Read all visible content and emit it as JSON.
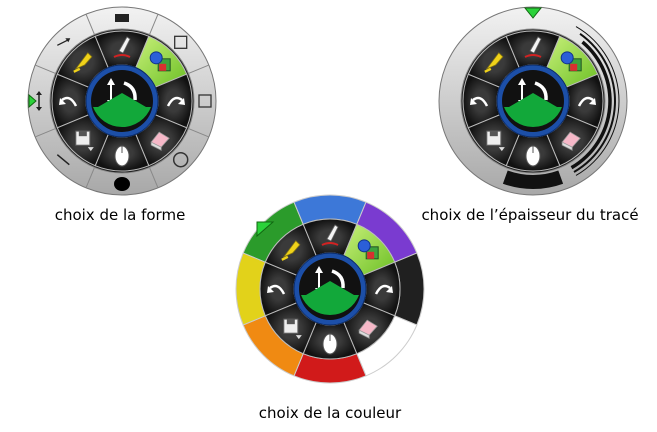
{
  "panels": [
    {
      "caption": "choix de la forme",
      "mode": "shape"
    },
    {
      "caption": "choix de l’épaisseur du tracé",
      "mode": "thickness"
    },
    {
      "caption": "choix de la couleur",
      "mode": "color"
    }
  ],
  "wheel": {
    "sectors": [
      {
        "name": "undo-icon",
        "interactable": true
      },
      {
        "name": "highlighter-icon",
        "interactable": true
      },
      {
        "name": "pen-icon",
        "interactable": true
      },
      {
        "name": "shapes-icon",
        "interactable": true,
        "selected": true
      },
      {
        "name": "redo-icon",
        "interactable": true
      },
      {
        "name": "eraser-icon",
        "interactable": true
      },
      {
        "name": "mouse-pointer-icon",
        "interactable": true
      },
      {
        "name": "save-icon",
        "interactable": true
      }
    ],
    "center": {
      "top": {
        "name": "move-rotate-icon",
        "interactable": true
      },
      "bottom": {
        "name": "active-color-swatch",
        "interactable": true,
        "color": "#12a83a"
      }
    },
    "accent": "#8fd63b",
    "hub_ring": "#1c4fa8",
    "marker_color": "#2bd23a"
  },
  "shape_ring": {
    "items": [
      {
        "name": "shape-line-thick-icon"
      },
      {
        "name": "shape-rectangle-outline-icon"
      },
      {
        "name": "shape-square-outline-icon"
      },
      {
        "name": "shape-ellipse-outline-icon"
      },
      {
        "name": "shape-ellipse-filled-icon"
      },
      {
        "name": "shape-line-thin-icon"
      },
      {
        "name": "shape-arrow-double-icon"
      },
      {
        "name": "shape-arrow-icon"
      }
    ]
  },
  "color_ring": {
    "colors": [
      "#2b9b2b",
      "#3d78d8",
      "#7a3bd0",
      "#202020",
      "#ffffff",
      "#d11a1a",
      "#f08a12",
      "#e2d21a"
    ]
  }
}
